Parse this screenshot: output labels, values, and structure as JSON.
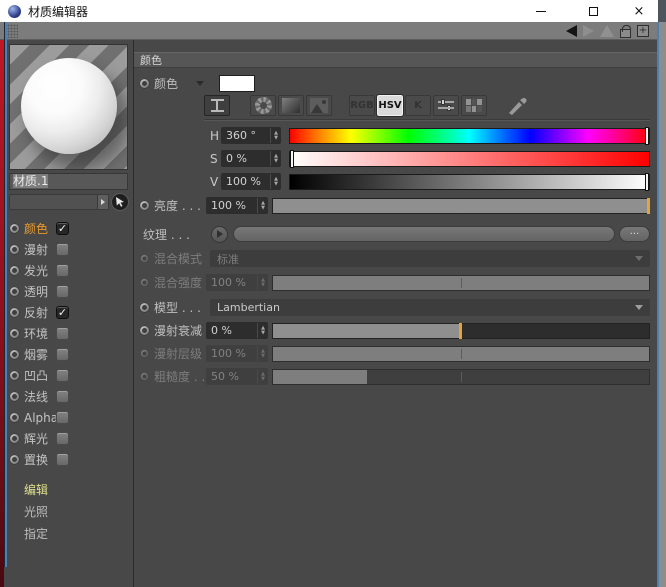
{
  "window": {
    "title": "材质编辑器"
  },
  "icons": {
    "check_glyph": "✓",
    "names": [
      "app-sphere-icon",
      "grip-handle",
      "back-arrow-icon",
      "forward-arrow-icon",
      "triangle-icon",
      "lock-icon",
      "add-icon",
      "compact-icon",
      "color-wheel-icon",
      "gradient-icon",
      "image-icon",
      "mixer-icon",
      "swatches-icon",
      "eyedropper-icon",
      "play-icon",
      "pick-arrow-icon",
      "minimize-icon",
      "maximize-icon",
      "close-icon"
    ]
  },
  "preview": {
    "material_name": "材质.1"
  },
  "channels": [
    {
      "label": "颜色",
      "checked": true,
      "active": true
    },
    {
      "label": "漫射",
      "checked": false,
      "active": false
    },
    {
      "label": "发光",
      "checked": false,
      "active": false
    },
    {
      "label": "透明",
      "checked": false,
      "active": false
    },
    {
      "label": "反射",
      "checked": true,
      "active": false
    },
    {
      "label": "环境",
      "checked": false,
      "active": false
    },
    {
      "label": "烟雾",
      "checked": false,
      "active": false
    },
    {
      "label": "凹凸",
      "checked": false,
      "active": false
    },
    {
      "label": "法线",
      "checked": false,
      "active": false
    },
    {
      "label": "Alpha",
      "checked": false,
      "active": false
    },
    {
      "label": "辉光",
      "checked": false,
      "active": false
    },
    {
      "label": "置换",
      "checked": false,
      "active": false
    }
  ],
  "sections": [
    {
      "label": "编辑",
      "active": true
    },
    {
      "label": "光照",
      "active": false
    },
    {
      "label": "指定",
      "active": false
    }
  ],
  "panel": {
    "header": "颜色",
    "color_row": {
      "label": "颜色"
    },
    "modes": {
      "rgb": "RGB",
      "hsv": "HSV",
      "k": "K"
    },
    "hue": {
      "label": "H",
      "value": "360 °",
      "handle_pct": 100
    },
    "saturation": {
      "label": "S",
      "value": "0 %",
      "handle_pct": 0
    },
    "value_row": {
      "label": "V",
      "value": "100 %",
      "handle_pct": 100
    },
    "brightness": {
      "label": "亮度 . . .",
      "value": "100 %",
      "fill_pct": 100,
      "handle": true,
      "tick": true
    },
    "texture": {
      "label": "纹理 . . .",
      "browse": "..."
    },
    "mix_mode": {
      "label": "混合模式",
      "value": "标准"
    },
    "mix_strength": {
      "label": "混合强度",
      "value": "100 %",
      "fill_pct": 100,
      "handle": false,
      "tick": true
    },
    "model": {
      "label": "模型 . . .",
      "value": "Lambertian"
    },
    "diffuse_falloff": {
      "label": "漫射衰减",
      "value": "0 %",
      "fill_pct": 50,
      "handle": true,
      "tick": false
    },
    "diffuse_level": {
      "label": "漫射层级",
      "value": "100 %",
      "fill_pct": 100,
      "handle": false,
      "tick": true
    },
    "roughness": {
      "label": "粗糙度 . .",
      "value": "50 %",
      "fill_pct": 25,
      "handle": false,
      "tick": true
    }
  },
  "colors": {
    "accent_orange": "#e8a23c",
    "active_channel": "#e89a2e",
    "section_highlight": "#dfe08c",
    "hsv_active_bg": "#d9d9d9"
  }
}
